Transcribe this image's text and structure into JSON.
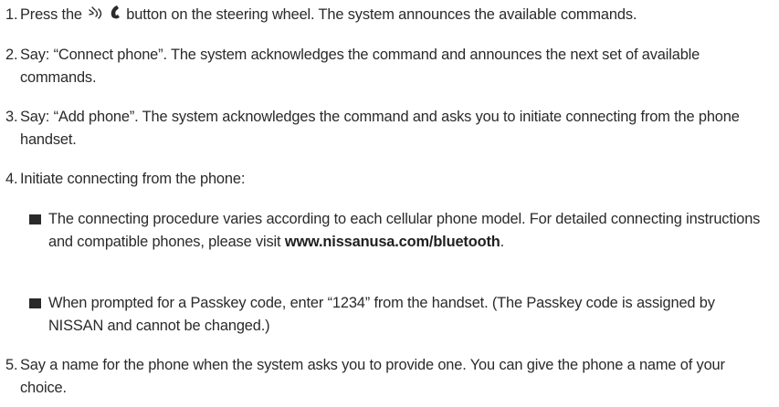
{
  "steps": [
    {
      "number": "1.",
      "text_before_icon": "Press the",
      "icon": "voice-phone-steering-button-icon",
      "text_after_icon": "button on the steering wheel. The system announces the available commands."
    },
    {
      "number": "2.",
      "text": "Say: “Connect phone”. The system acknowledges the command and announces the next set of available commands."
    },
    {
      "number": "3.",
      "text": "Say: “Add phone”. The system acknowledges the command and asks you to initiate connecting from the phone handset."
    },
    {
      "number": "4.",
      "text": "Initiate connecting from the phone:",
      "bullets": [
        {
          "text": "The connecting procedure varies according to each cellular phone model. For detailed connecting instructions and compatible phones, please visit",
          "link": "www.nissanusa.com/bluetooth",
          "suffix": "."
        },
        {
          "text": "When prompted for a Passkey code, enter “1234” from the handset. (The Passkey code is assigned by NISSAN and cannot be changed.)"
        }
      ]
    },
    {
      "number": "5.",
      "text": "Say a name for the phone when the system asks you to provide one. You can give the phone a name of your choice."
    }
  ],
  "colors": {
    "text": "#2a2a2a",
    "background": "#ffffff",
    "bullet": "#2a2a2a"
  }
}
